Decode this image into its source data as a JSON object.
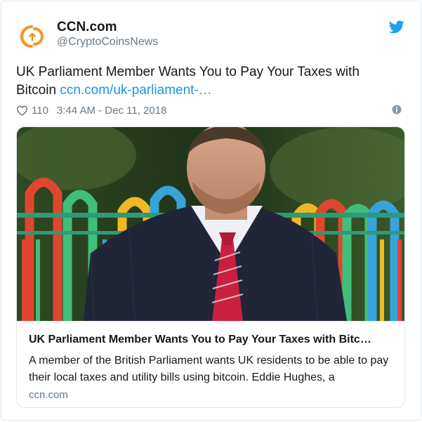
{
  "author": {
    "name": "CCN.com",
    "handle": "@CryptoCoinsNews"
  },
  "tweet": {
    "text": "UK Parliament Member Wants You to Pay Your Taxes with Bitcoin ",
    "link_text": "ccn.com/uk-parliament-…",
    "like_count": "110",
    "timestamp": "3:44 AM - Dec 11, 2018"
  },
  "card": {
    "title": "UK Parliament Member Wants You to Pay Your Taxes with Bitc…",
    "description": "A member of the British Parliament wants UK residents to be able to pay their local taxes and utility bills using bitcoin. Eddie Hughes, a",
    "domain": "ccn.com"
  },
  "icons": {
    "avatar": "ccn-logo-icon",
    "brand": "twitter-bird-icon",
    "like": "heart-outline-icon",
    "info": "info-circle-icon"
  },
  "colors": {
    "accent": "#1b95e0",
    "logo_orange": "#f29422",
    "muted_text": "#657786",
    "border": "#e1e8ed"
  }
}
